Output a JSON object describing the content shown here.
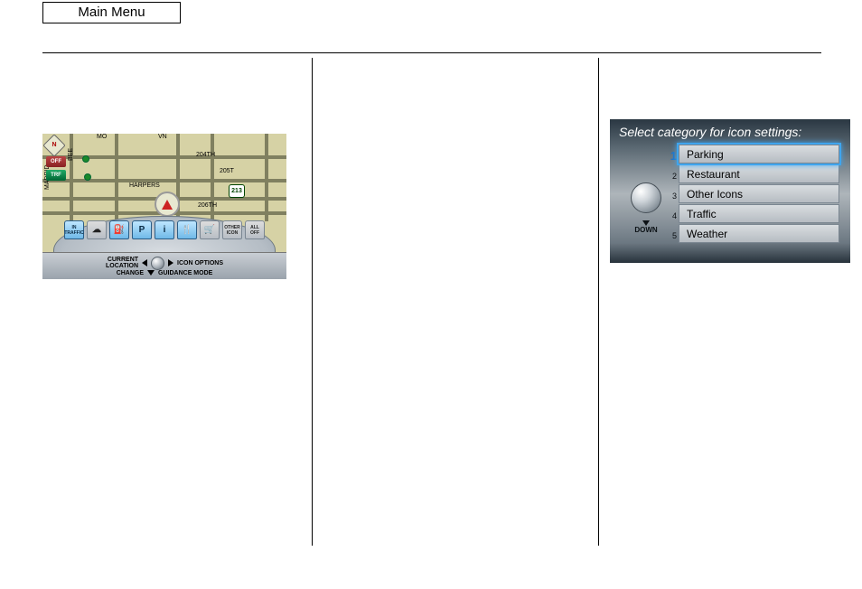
{
  "header": {
    "title": "Main Menu"
  },
  "map": {
    "compass_letter": "N",
    "badge_off": "OFF",
    "badge_trf": "TRF",
    "streets": {
      "harpers": "HARPERS",
      "s204": "204TH",
      "s205": "205T",
      "s206": "206TH",
      "madrid": "MADRID",
      "bee": "BEE",
      "mo": "MO",
      "vn": "VN"
    },
    "shield": "213",
    "icons": {
      "traffic": "IN\nTRAFFIC",
      "gas": "⛽",
      "parking": "P",
      "info": "i",
      "restaurant": "🍴",
      "shop": "🛒",
      "other": "OTHER\nICON",
      "all_off": "ALL\nOFF"
    },
    "controls": {
      "current_location": "CURRENT\nLOCATION",
      "icon_options": "ICON OPTIONS",
      "change": "CHANGE",
      "guidance_mode": "GUIDANCE MODE"
    }
  },
  "category": {
    "header": "Select category for icon settings:",
    "down_label": "DOWN",
    "items": [
      {
        "n": "1",
        "label": "Parking"
      },
      {
        "n": "2",
        "label": "Restaurant"
      },
      {
        "n": "3",
        "label": "Other Icons"
      },
      {
        "n": "4",
        "label": "Traffic"
      },
      {
        "n": "5",
        "label": "Weather"
      }
    ]
  }
}
